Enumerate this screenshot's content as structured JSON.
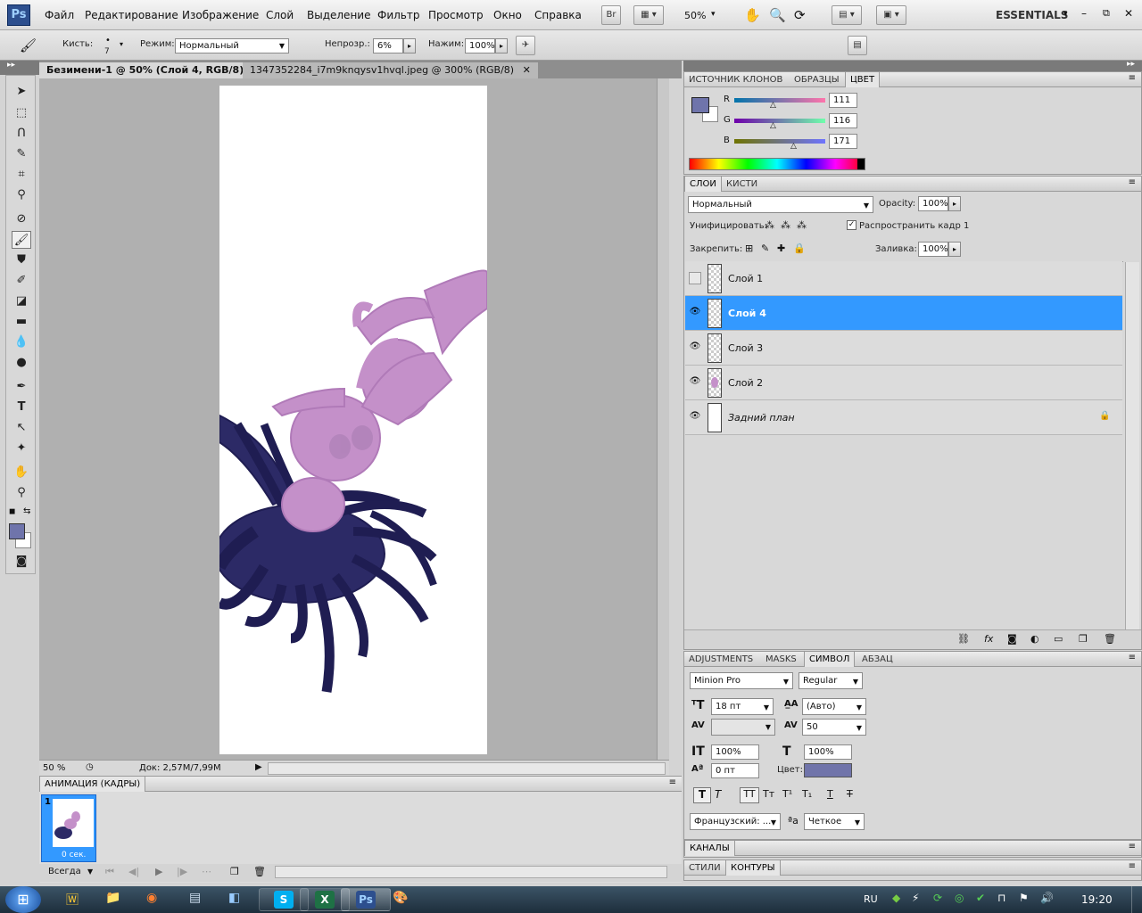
{
  "app": {
    "logo": "Ps"
  },
  "menu": [
    "Файл",
    "Редактирование",
    "Изображение",
    "Слой",
    "Выделение",
    "Фильтр",
    "Просмотр",
    "Окно",
    "Справка"
  ],
  "menubar": {
    "bridge": "Br",
    "zoom": "50%",
    "workspace": "ESSENTIALS"
  },
  "options": {
    "brush_label": "Кисть:",
    "brush_size": "7",
    "mode_label": "Режим:",
    "mode_value": "Нормальный",
    "opacity_label": "Непрозр.:",
    "opacity_value": "6%",
    "flow_label": "Нажим:",
    "flow_value": "100%"
  },
  "doc_tabs": [
    {
      "label": "Безимени-1 @ 50% (Слой 4, RGB/8) *"
    },
    {
      "label": "1347352284_i7m9knqysv1hvql.jpeg @ 300% (RGB/8)"
    }
  ],
  "status": {
    "zoom": "50 %",
    "doc": "Док: 2,57M/7,99M"
  },
  "animation": {
    "title": "АНИМАЦИЯ (КАДРЫ)",
    "frame_number": "1",
    "frame_time": "0 сек.",
    "loop": "Всегда"
  },
  "color_panel": {
    "tabs": [
      "ИСТОЧНИК КЛОНОВ",
      "ОБРАЗЦЫ",
      "ЦВЕТ"
    ],
    "r_label": "R",
    "g_label": "G",
    "b_label": "B",
    "r": "111",
    "g": "116",
    "b": "171",
    "foreground": "#6f74ab"
  },
  "layers_panel": {
    "tabs": [
      "СЛОИ",
      "КИСТИ"
    ],
    "blend": "Нормальный",
    "opacity_label": "Opacity:",
    "opacity": "100%",
    "unify_label": "Унифицировать:",
    "propagate_label": "Распространить кадр 1",
    "lock_label": "Закрепить:",
    "fill_label": "Заливка:",
    "fill": "100%",
    "layers": [
      {
        "name": "Слой 1",
        "visible": false,
        "selected": false
      },
      {
        "name": "Слой 4",
        "visible": true,
        "selected": true
      },
      {
        "name": "Слой 3",
        "visible": true,
        "selected": false
      },
      {
        "name": "Слой 2",
        "visible": true,
        "selected": false
      },
      {
        "name": "Задний план",
        "visible": true,
        "selected": false
      }
    ]
  },
  "char_panel": {
    "tabs": [
      "ADJUSTMENTS",
      "MASKS",
      "СИМВОЛ",
      "АБЗАЦ"
    ],
    "font": "Minion Pro",
    "style": "Regular",
    "size": "18 пт",
    "leading": "(Авто)",
    "tracking": "50",
    "vscale": "100%",
    "hscale": "100%",
    "baseline": "0 пт",
    "color_label": "Цвет:",
    "language": "Французский: ...",
    "aa_label": "ªa",
    "antialias": "Четкое",
    "text_color": "#7074aa"
  },
  "channels_panel": {
    "title": "КАНАЛЫ"
  },
  "paths_panel": {
    "tabs": [
      "СТИЛИ",
      "КОНТУРЫ"
    ]
  },
  "taskbar": {
    "lang": "RU",
    "time": "19:20",
    "apps": [
      "W",
      "S",
      "X",
      "Ps"
    ]
  }
}
